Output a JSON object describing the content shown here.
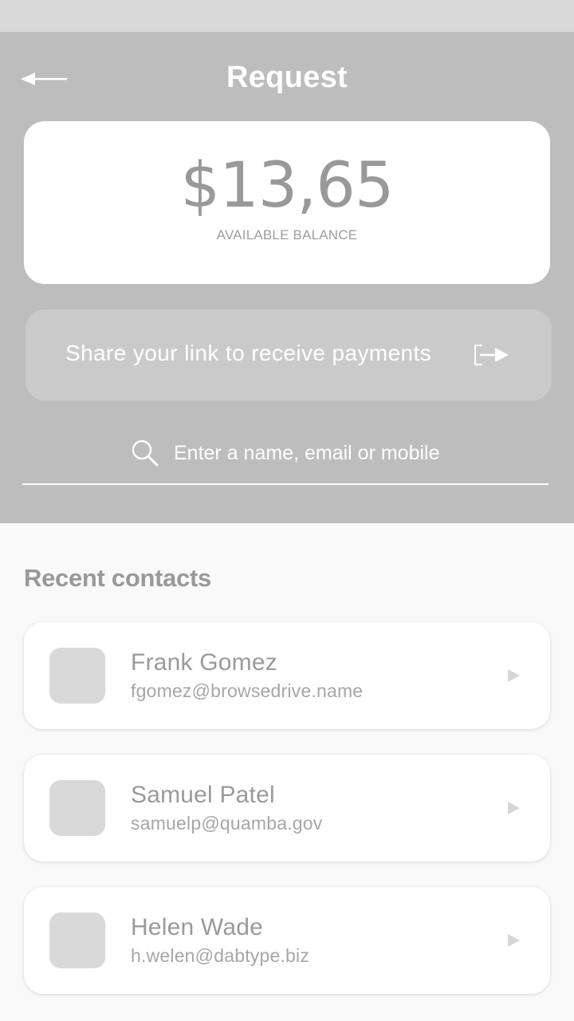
{
  "header": {
    "title": "Request",
    "back_icon": "arrow-left-icon"
  },
  "balance": {
    "amount": "$13,65",
    "label": "AVAILABLE BALANCE"
  },
  "share": {
    "label": "Share your link to receive payments",
    "icon": "share-exit-icon"
  },
  "search": {
    "placeholder": "Enter a name, email or mobile",
    "value": "",
    "icon": "search-icon"
  },
  "recent": {
    "title": "Recent contacts",
    "contacts": [
      {
        "name": "Frank Gomez",
        "email": "fgomez@browsedrive.name"
      },
      {
        "name": "Samuel Patel",
        "email": "samuelp@quamba.gov"
      },
      {
        "name": "Helen Wade",
        "email": "h.welen@dabtype.biz"
      }
    ]
  },
  "colors": {
    "status_bar": "#d9d9d9",
    "header_background": "#bdbdbd",
    "page_background": "#f9f9f9",
    "card_background": "#ffffff",
    "share_button": "#cacaca",
    "avatar_placeholder": "#d9d9d9",
    "text_gray": "#999999"
  }
}
